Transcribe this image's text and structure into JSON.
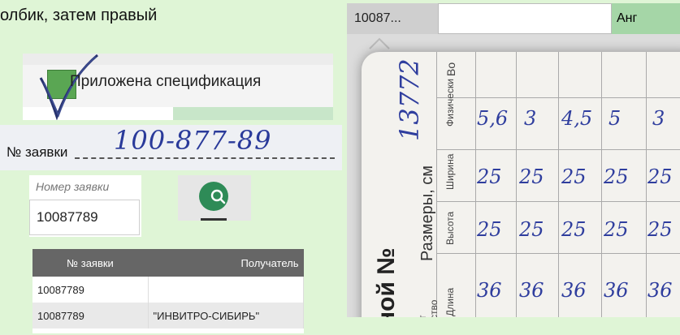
{
  "instruction": "олбик, затем правый",
  "checkbox": {
    "label": "Приложена спецификация",
    "checked": true
  },
  "handwritten_number": {
    "label": "№ заявки",
    "value": "100-877-89"
  },
  "search": {
    "caption": "Номер заявки",
    "value": "10087789",
    "button_icon": "search-icon",
    "accent": "#2e8b57"
  },
  "table": {
    "columns": [
      "№ заявки",
      "Получатель"
    ],
    "rows": [
      [
        "10087789",
        ""
      ],
      [
        "10087789",
        "\"ИНВИТРО-СИБИРЬ\""
      ]
    ]
  },
  "top_right": {
    "id_text": "10087...",
    "input_value": "",
    "name_text": "Анг"
  },
  "photo": {
    "title": "ной №",
    "number": "13772",
    "sizes_label": "Размеры, см",
    "headers": [
      "Длина",
      "Высота",
      "Ширина",
      "Физически"
    ],
    "side_header": "Во",
    "left_text": "ство",
    "left_text2": "т",
    "rows": [
      [
        "36",
        "25",
        "25",
        "5,6"
      ],
      [
        "36",
        "25",
        "25",
        "3"
      ],
      [
        "36",
        "25",
        "25",
        "4,5"
      ],
      [
        "36",
        "25",
        "25",
        "5"
      ],
      [
        "36",
        "25",
        "25",
        "3"
      ]
    ]
  }
}
